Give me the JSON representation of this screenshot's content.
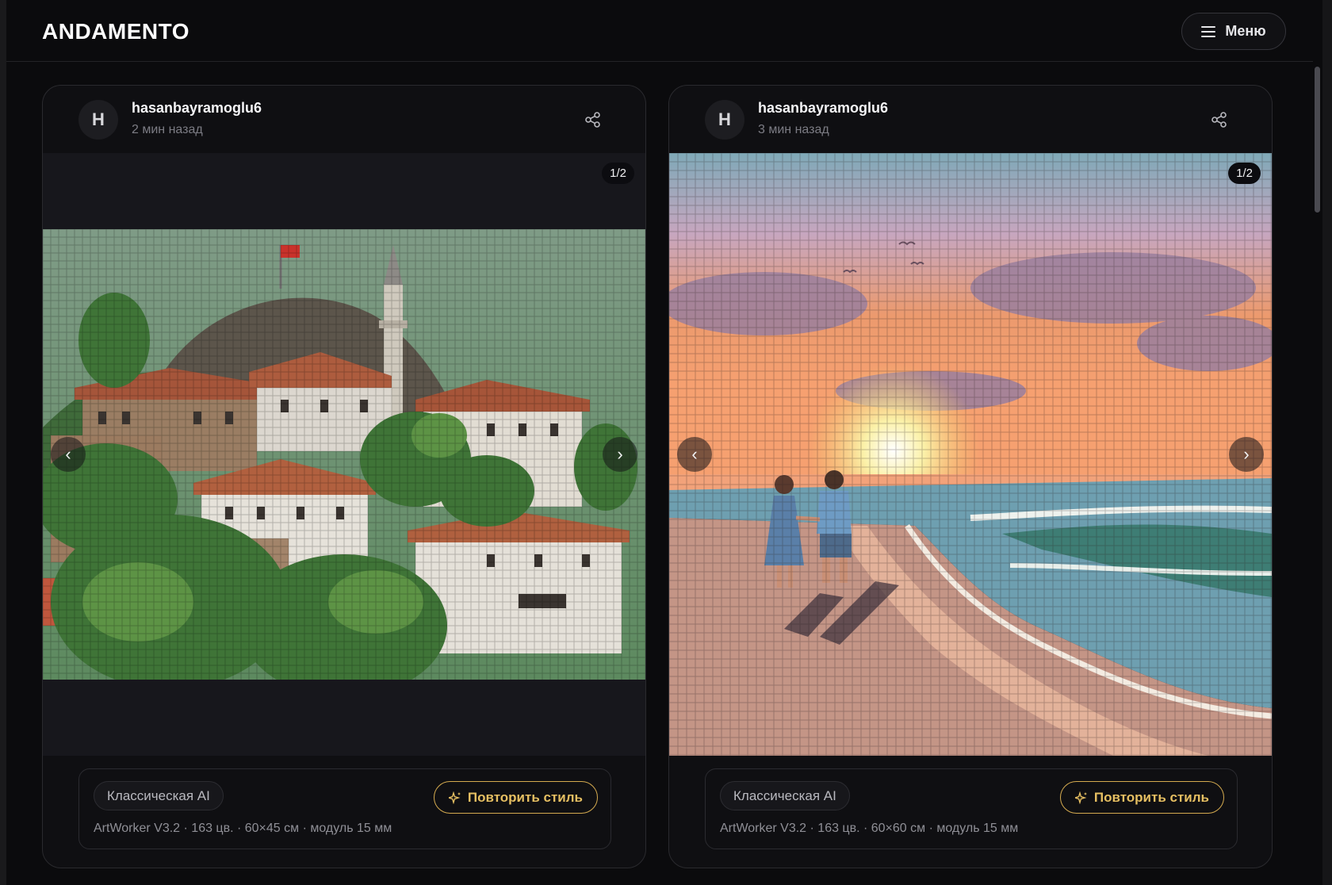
{
  "header": {
    "logo": "ANDAMENTO",
    "menu_label": "Меню",
    "menu_icon": "hamburger-icon"
  },
  "posts": [
    {
      "avatar_letter": "H",
      "username": "hasanbayramoglu6",
      "time": "2 мин назад",
      "counter": "1/2",
      "image_subject": "mosaic of a hillside Turkish town with Ottoman houses, a minaret and a Turkish flag",
      "style_chip": "Классическая AI",
      "repeat_label": "Повторить стиль",
      "meta": "ArtWorker V3.2 · 163 цв. · 60×45 см · модуль 15 мм"
    },
    {
      "avatar_letter": "H",
      "username": "hasanbayramoglu6",
      "time": "3 мин назад",
      "counter": "1/2",
      "image_subject": "mosaic of a couple walking on a beach at sunset",
      "style_chip": "Классическая AI",
      "repeat_label": "Повторить стиль",
      "meta": "ArtWorker V3.2 · 163 цв. · 60×60 см · модуль 15 мм"
    }
  ],
  "colors": {
    "background": "#0b0b0d",
    "card": "#0f0f12",
    "accent_gold": "#e6bf62"
  }
}
